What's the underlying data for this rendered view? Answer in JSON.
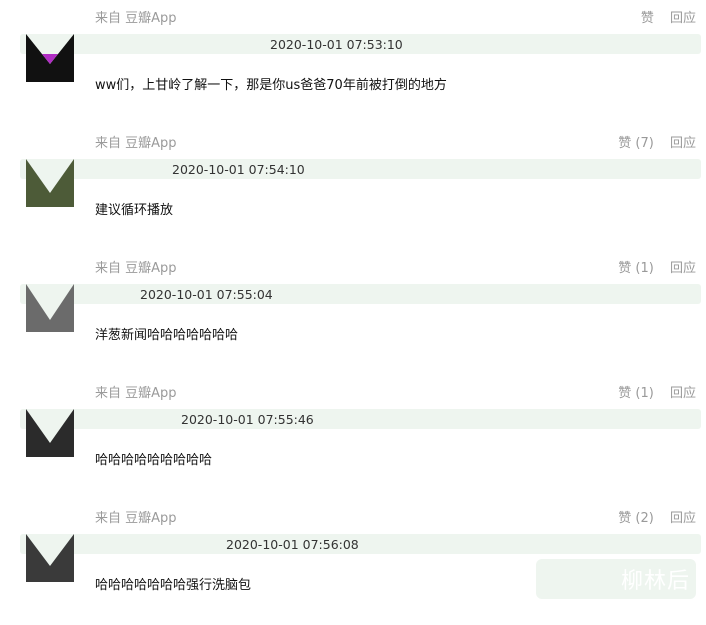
{
  "comments": [
    {
      "source": "来自 豆瓣App",
      "likes": "赞",
      "reply": "回应",
      "time": "2020-10-01 07:53:10",
      "text": "ww们，上甘岭了解一下，那是你us爸爸70年前被打倒的地方",
      "avatar_color": "#111111",
      "accent": "#b12ec4"
    },
    {
      "source": "来自 豆瓣App",
      "likes": "赞 (7)",
      "reply": "回应",
      "time": "2020-10-01 07:54:10",
      "text": "建议循环播放",
      "avatar_color": "#4d5b38",
      "accent": "#c9d4b0"
    },
    {
      "source": "来自 豆瓣App",
      "likes": "赞 (1)",
      "reply": "回应",
      "time": "2020-10-01 07:55:04",
      "text": "洋葱新闻哈哈哈哈哈哈哈",
      "avatar_color": "#6b6b6b",
      "accent": "#d8d8d8"
    },
    {
      "source": "来自 豆瓣App",
      "likes": "赞 (1)",
      "reply": "回应",
      "time": "2020-10-01 07:55:46",
      "text": "哈哈哈哈哈哈哈哈哈",
      "avatar_color": "#2b2b2b",
      "accent": "#9a9a9a"
    },
    {
      "source": "来自 豆瓣App",
      "likes": "赞 (2)",
      "reply": "回应",
      "time": "2020-10-01 07:56:08",
      "text": "哈哈哈哈哈哈哈强行洗脑包",
      "avatar_color": "#3a3a3a",
      "accent": "#cfcfcf"
    }
  ],
  "watermark": "柳林后"
}
